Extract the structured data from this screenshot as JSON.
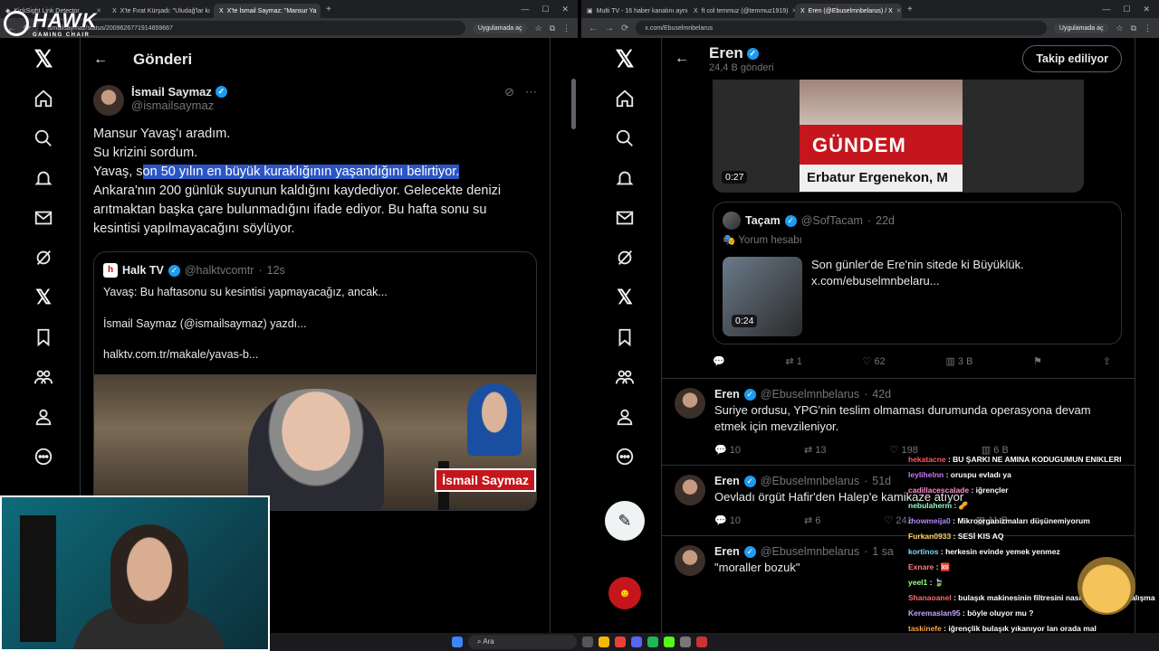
{
  "overlay": {
    "brand": "HAWK",
    "brand_sub": "GAMING CHAIR"
  },
  "left": {
    "tabs": [
      {
        "label": "KickSight Link Detector",
        "active": false
      },
      {
        "label": "X'te Fırat Kürşadı: \"Uludağ'lar kı",
        "active": false
      },
      {
        "label": "X'te İsmail Saymaz: \"Mansur Ya",
        "active": true
      }
    ],
    "url": "ismailsaymaz/status/2009626771914859667",
    "chip": "Uygulamada aç",
    "header": "Gönderi",
    "post": {
      "name": "İsmail Saymaz",
      "handle": "@ismailsaymaz",
      "line1": "Mansur Yavaş'ı aradım.",
      "line2": "Su krizini sordum.",
      "line3_pre": "Yavaş, s",
      "line3_hl": "on 50 yılın en büyük kuraklığının yaşandığını belirtiyor.",
      "line4": "Ankara'nın 200 günlük suyunun kaldığını kaydediyor. Gelecekte denizi arıtmaktan başka çare bulunmadığını ifade ediyor. Bu hafta sonu su kesintisi yapılmayacağını söylüyor."
    },
    "quote": {
      "name": "Halk TV",
      "handle": "@halktvcomtr",
      "time": "12s",
      "l1": "Yavaş: Bu haftasonu su kesintisi yapmayacağız, ancak...",
      "l2": "İsmail Saymaz (@ismailsaymaz) yazdı...",
      "l3": "halktv.com.tr/makale/yavas-b...",
      "img_tag": "İsmail Saymaz"
    }
  },
  "right": {
    "tabs": [
      {
        "label": "Multi TV - 16 haber kanalını aynı",
        "active": false
      },
      {
        "label": "ft col temmuz (@temmuz1919)",
        "active": false
      },
      {
        "label": "Eren (@Ebuselmnbelarus) / X",
        "active": true
      }
    ],
    "url": "x.com/Ebuselmnbelarus",
    "chip": "Uygulamada aç",
    "profile": {
      "name": "Eren",
      "posts": "24,4 B gönderi",
      "follow": "Takip ediliyor"
    },
    "media": {
      "duration": "0:27",
      "red_text": "GÜNDEM",
      "strip_text": "Erbatur Ergenekon, M"
    },
    "inner": {
      "name": "Taçam",
      "handle": "@SofTacam",
      "time": "22d",
      "sub": "Yorum hesabı",
      "text1": "Son günler'de Ere'nin sitede ki Büyüklük.",
      "text2": "x.com/ebuselmnbelaru...",
      "duration": "0:24"
    },
    "inner_actions": {
      "rt": "1",
      "like": "62",
      "views": "3 B"
    },
    "tweets": [
      {
        "name": "Eren",
        "handle": "@Ebuselmnbelarus",
        "time": "42d",
        "text": "Suriye ordusu, YPG'nin teslim olmaması durumunda operasyona devam etmek için mevzileniyor.",
        "reply": "10",
        "rt": "13",
        "like": "198",
        "views": "6 B"
      },
      {
        "name": "Eren",
        "handle": "@Ebuselmnbelarus",
        "time": "51d",
        "text": "Oevladı örgüt Hafir'den Halep'e kamikaze atıyor",
        "reply": "10",
        "rt": "6",
        "like": "241",
        "views": "11 B"
      },
      {
        "name": "Eren",
        "handle": "@Ebuselmnbelarus",
        "time": "1 sa",
        "text": "\"moraller bozuk\""
      }
    ]
  },
  "chat": [
    {
      "user": "hekatacne",
      "color": "#ff5a5a",
      "msg": "BU ŞARKI NE AMINA KODUGUMUN ENIKLERI"
    },
    {
      "user": "leylihelnn",
      "color": "#c77dff",
      "msg": "oruspu evladı ya"
    },
    {
      "user": "cadillacescalade",
      "color": "#ff8fd1",
      "msg": "iğrençler"
    },
    {
      "user": "nebulaherm",
      "color": "#8affc1",
      "msg": "🥜"
    },
    {
      "user": "rhowmeija0",
      "color": "#b388ff",
      "msg": "Mikroorganizmaları düşünemiyorum"
    },
    {
      "user": "Furkan0933",
      "color": "#ffd166",
      "msg": "SESİ KIS AQ"
    },
    {
      "user": "kortinos",
      "color": "#7bdcff",
      "msg": "herkesin evinde yemek yenmez"
    },
    {
      "user": "Exnare",
      "color": "#ff7b7b",
      "msg": "🆘"
    },
    {
      "user": "yeel1",
      "color": "#9cff8a",
      "msg": "🍃"
    },
    {
      "user": "Shanaoanel",
      "color": "#ff6b6b",
      "msg": "bulaşık makinesinin filtresini nasıl sikeriz adlı çalışma"
    },
    {
      "user": "Keremaslan95",
      "color": "#c7a4ff",
      "msg": "böyle oluyor mu ?"
    },
    {
      "user": "taskinefe",
      "color": "#ff9f43",
      "msg": "iğrençlik bulaşık yıkanıyor lan orada mal"
    }
  ],
  "taskbar": {
    "search": "Ara",
    "time": "05"
  }
}
